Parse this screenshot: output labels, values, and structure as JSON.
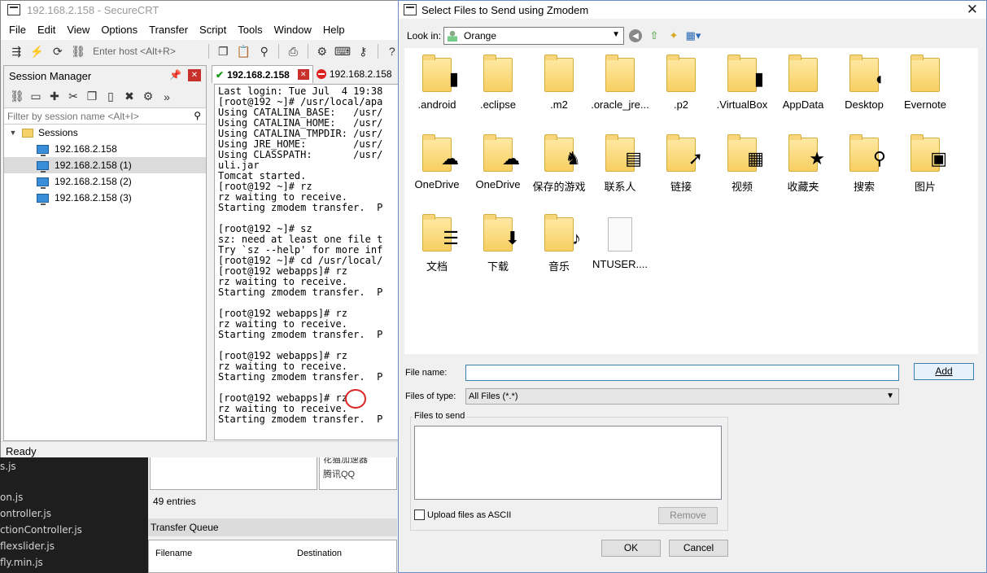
{
  "crt": {
    "title": "192.168.2.158 - SecureCRT",
    "menu": [
      "File",
      "Edit",
      "View",
      "Options",
      "Transfer",
      "Script",
      "Tools",
      "Window",
      "Help"
    ],
    "host_placeholder": "Enter host <Alt+R>",
    "session_manager": {
      "title": "Session Manager",
      "filter_placeholder": "Filter by session name <Alt+I>",
      "root": "Sessions",
      "sessions": [
        "192.168.2.158",
        "192.168.2.158 (1)",
        "192.168.2.158 (2)",
        "192.168.2.158 (3)"
      ],
      "selected_index": 1
    },
    "tabs": [
      {
        "label": "192.168.2.158",
        "status": "connected"
      },
      {
        "label": "192.168.2.158",
        "status": "disconnected"
      }
    ],
    "terminal_text": "Last login: Tue Jul  4 19:38\n[root@192 ~]# /usr/local/apa\nUsing CATALINA_BASE:   /usr/\nUsing CATALINA_HOME:   /usr/\nUsing CATALINA_TMPDIR: /usr/\nUsing JRE_HOME:        /usr/\nUsing CLASSPATH:       /usr/\nuli.jar\nTomcat started.\n[root@192 ~]# rz\nrz waiting to receive.\nStarting zmodem transfer.  P\n\n[root@192 ~]# sz\nsz: need at least one file t\nTry `sz --help' for more inf\n[root@192 ~]# cd /usr/local/\n[root@192 webapps]# rz\nrz waiting to receive.\nStarting zmodem transfer.  P\n\n[root@192 webapps]# rz\nrz waiting to receive.\nStarting zmodem transfer.  P\n\n[root@192 webapps]# rz\nrz waiting to receive.\nStarting zmodem transfer.  P\n\n[root@192 webapps]# rz\nrz waiting to receive.\nStarting zmodem transfer.  P",
    "status": "Ready"
  },
  "background": {
    "editor_lines": [
      "s.js",
      "on.js",
      "ontroller.js",
      "ctionController.js",
      "flexslider.js",
      "fly.min.js"
    ],
    "list_items": [
      "花猫加速器",
      "腾讯QQ"
    ],
    "entries": "49 entries",
    "transfer_queue": "Transfer Queue",
    "queue_columns": [
      "Filename",
      "Destination"
    ]
  },
  "dialog": {
    "title": "Select Files to Send using Zmodem",
    "look_in_label": "Look in:",
    "look_in_value": "Orange",
    "files": [
      {
        "name": ".android",
        "type": "folder",
        "badge": "▮"
      },
      {
        "name": ".eclipse",
        "type": "folder",
        "badge": ""
      },
      {
        "name": ".m2",
        "type": "folder",
        "badge": ""
      },
      {
        "name": ".oracle_jre...",
        "type": "folder",
        "badge": ""
      },
      {
        "name": ".p2",
        "type": "folder",
        "badge": ""
      },
      {
        "name": ".VirtualBox",
        "type": "folder",
        "badge": "▮"
      },
      {
        "name": "AppData",
        "type": "folder",
        "badge": ""
      },
      {
        "name": "Desktop",
        "type": "folder",
        "badge": "◐"
      },
      {
        "name": "Evernote",
        "type": "folder",
        "badge": ""
      },
      {
        "name": "OneDrive",
        "type": "folder",
        "badge": "☁"
      },
      {
        "name": "OneDrive",
        "type": "folder",
        "badge": "☁"
      },
      {
        "name": "保存的游戏",
        "type": "folder",
        "badge": "♞"
      },
      {
        "name": "联系人",
        "type": "folder",
        "badge": "▤"
      },
      {
        "name": "链接",
        "type": "folder",
        "badge": "➚"
      },
      {
        "name": "视频",
        "type": "folder",
        "badge": "▦"
      },
      {
        "name": "收藏夹",
        "type": "folder",
        "badge": "★"
      },
      {
        "name": "搜索",
        "type": "folder",
        "badge": "⚲"
      },
      {
        "name": "图片",
        "type": "folder",
        "badge": "▣"
      },
      {
        "name": "文档",
        "type": "folder",
        "badge": "☰"
      },
      {
        "name": "下载",
        "type": "folder",
        "badge": "⬇"
      },
      {
        "name": "音乐",
        "type": "folder",
        "badge": "♪"
      },
      {
        "name": "NTUSER....",
        "type": "file",
        "badge": ""
      }
    ],
    "file_name_label": "File name:",
    "file_name_value": "",
    "add_label": "Add",
    "file_type_label": "Files of type:",
    "file_type_value": "All Files (*.*)",
    "files_to_send_label": "Files to send",
    "upload_ascii_label": "Upload files as ASCII",
    "remove_label": "Remove",
    "ok_label": "OK",
    "cancel_label": "Cancel"
  },
  "colors": {
    "folder": "#f7cf62",
    "close_red": "#c8302c",
    "accent_blue": "#3c7fb1",
    "annotation_red": "#dd2222"
  }
}
